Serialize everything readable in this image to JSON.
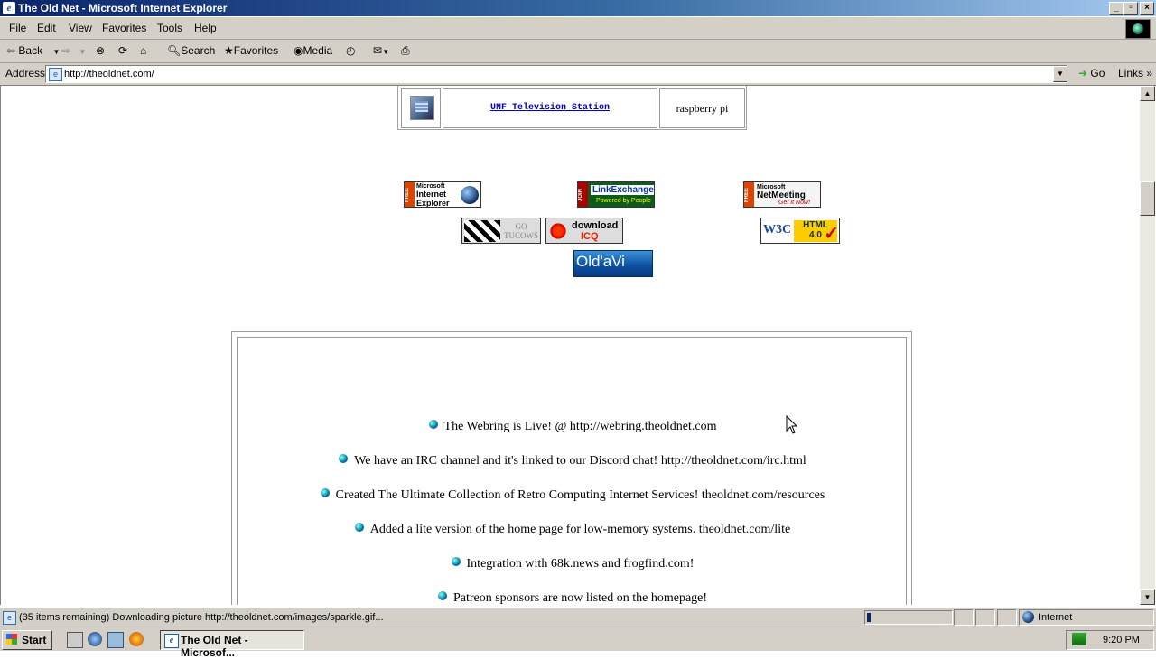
{
  "window": {
    "title": "The Old Net - Microsoft Internet Explorer",
    "controls": [
      "_",
      "▫",
      "×"
    ]
  },
  "menu": [
    "File",
    "Edit",
    "View",
    "Favorites",
    "Tools",
    "Help"
  ],
  "toolbar": {
    "back_label": "Back",
    "search_label": "Search",
    "favorites_label": "Favorites",
    "media_label": "Media"
  },
  "address": {
    "label": "Address",
    "url": "http://theoldnet.com/",
    "go_label": "Go",
    "links_label": "Links"
  },
  "page": {
    "top_table": {
      "link_text": "UNF Television Station",
      "cell_text": "raspberry pi"
    },
    "badges": {
      "ie": {
        "free": "FREE",
        "line1": "Microsoft",
        "line2": "Internet",
        "line3": "Explorer"
      },
      "linkexchange": {
        "free": "JOIN",
        "title": "LinkExchange",
        "sub": "Powered by People"
      },
      "netmeeting": {
        "free": "FREE",
        "line1": "Microsoft",
        "line2": "NetMeeting",
        "sub": "Get It Now!"
      },
      "tucows": {
        "line1": "GO",
        "line2": "TUCOWS"
      },
      "icq": {
        "line1": "download",
        "line2": "ICQ"
      },
      "w3c": {
        "logo": "W3C",
        "line1": "HTML",
        "line2": "4.0"
      },
      "oldavi": {
        "text": "Old'aVi"
      }
    },
    "news": [
      "The Webring is Live! @ http://webring.theoldnet.com",
      "We have an IRC channel and it's linked to our Discord chat! http://theoldnet.com/irc.html",
      "Created The Ultimate Collection of Retro Computing Internet Services! theoldnet.com/resources",
      "Added a lite version of the home page for low-memory systems. theoldnet.com/lite",
      "Integration with 68k.news and frogfind.com!",
      "Patreon sponsors are now listed on the homepage!"
    ]
  },
  "status": {
    "text": "(35 items remaining) Downloading picture http://theoldnet.com/images/sparkle.gif...",
    "progress": 0.04,
    "zone": "Internet"
  },
  "taskbar": {
    "start_label": "Start",
    "window_label": "The Old Net - Microsof...",
    "clock": "9:20 PM"
  }
}
